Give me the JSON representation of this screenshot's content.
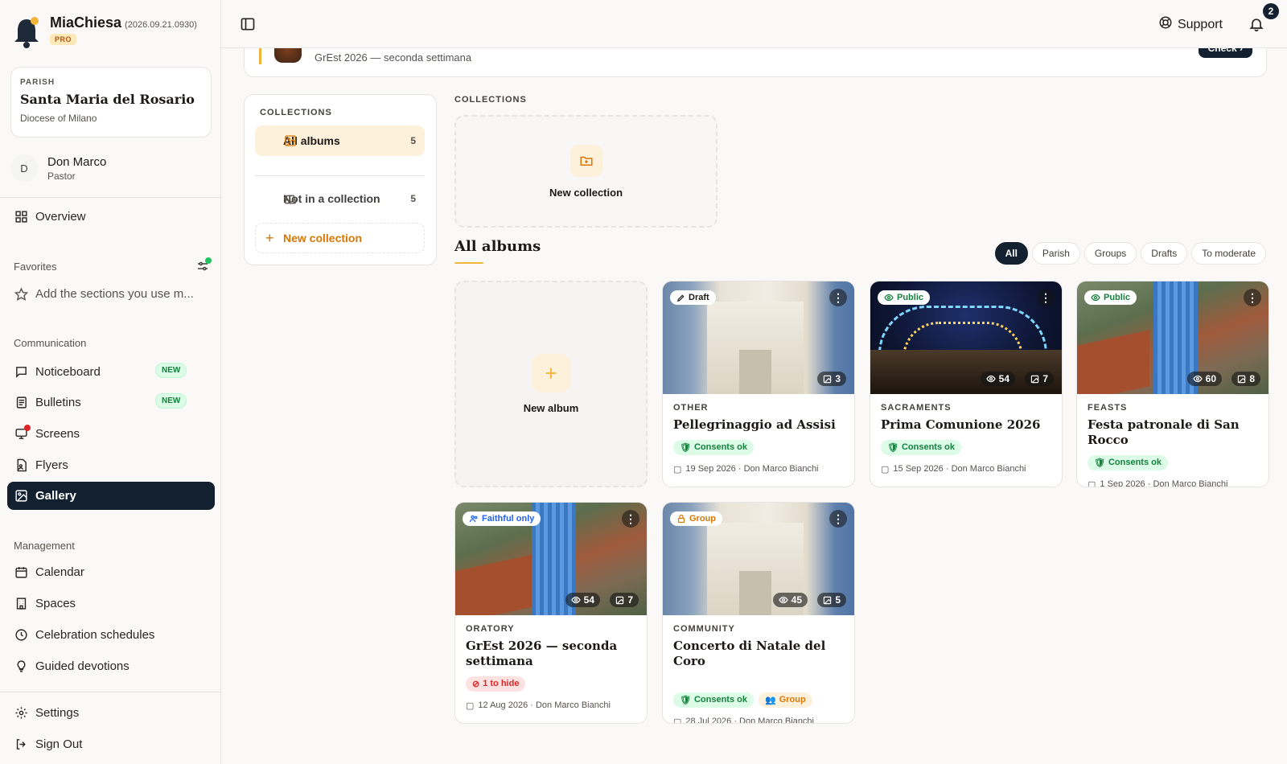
{
  "app": {
    "name": "MiaChiesa",
    "version": "(2026.09.21.0930)",
    "tier": "PRO"
  },
  "parish": {
    "label": "PARISH",
    "name": "Santa Maria del Rosario",
    "diocese": "Diocese of Milano"
  },
  "user": {
    "initial": "D",
    "name": "Don Marco",
    "role": "Pastor"
  },
  "nav": {
    "overview": "Overview",
    "favorites_header": "Favorites",
    "favorites_hint": "Add the sections you use m...",
    "communication_header": "Communication",
    "noticeboard": "Noticeboard",
    "bulletins": "Bulletins",
    "new_badge": "NEW",
    "screens": "Screens",
    "flyers": "Flyers",
    "gallery": "Gallery",
    "management_header": "Management",
    "calendar": "Calendar",
    "spaces": "Spaces",
    "celebration": "Celebration schedules",
    "devotions": "Guided devotions",
    "settings": "Settings",
    "signout": "Sign Out"
  },
  "topbar": {
    "support": "Support",
    "notifications": "2"
  },
  "banner": {
    "text": "GrEst 2026 — seconda settimana",
    "button": "Check ›"
  },
  "collections_panel": {
    "header": "COLLECTIONS",
    "all_albums": "All albums",
    "all_count": "5",
    "not_in_collection": "Not in a collection",
    "not_count": "5",
    "new_collection": "New collection"
  },
  "main": {
    "collections_label": "COLLECTIONS",
    "new_collection": "New collection",
    "all_albums_title": "All albums",
    "new_album": "New album",
    "filters": [
      "All",
      "Parish",
      "Groups",
      "Drafts",
      "To moderate"
    ]
  },
  "albums": [
    {
      "status": "Draft",
      "category": "OTHER",
      "title": "Pellegrinaggio ad Assisi",
      "views": "",
      "photos": "3",
      "tags": [
        "Consents ok"
      ],
      "meta": "19 Sep 2026 · Don Marco Bianchi"
    },
    {
      "status": "Public",
      "category": "SACRAMENTS",
      "title": "Prima Comunione 2026",
      "views": "54",
      "photos": "7",
      "tags": [
        "Consents ok"
      ],
      "meta": "15 Sep 2026 · Don Marco Bianchi"
    },
    {
      "status": "Public",
      "category": "FEASTS",
      "title": "Festa patronale di San Rocco",
      "views": "60",
      "photos": "8",
      "tags": [
        "Consents ok"
      ],
      "meta": "1 Sep 2026 · Don Marco Bianchi"
    },
    {
      "status": "Faithful only",
      "category": "ORATORY",
      "title": "GrEst 2026 — seconda settimana",
      "views": "54",
      "photos": "7",
      "tags": [
        "1 to hide"
      ],
      "meta": "12 Aug 2026 · Don Marco Bianchi"
    },
    {
      "status": "Group",
      "category": "COMMUNITY",
      "title": "Concerto di Natale del Coro",
      "views": "45",
      "photos": "5",
      "tags": [
        "Consents ok",
        "Group"
      ],
      "meta": "28 Jul 2026 · Don Marco Bianchi"
    }
  ],
  "colors": {
    "accent": "#f0b53a",
    "dark": "#13202f",
    "ok": "#15803d",
    "danger": "#dc2626",
    "amber": "#d97706"
  }
}
